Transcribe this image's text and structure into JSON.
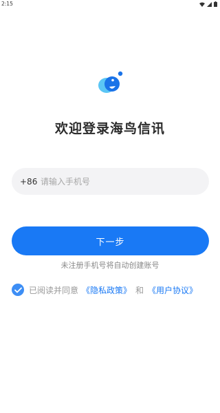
{
  "status_bar": {
    "time": "2:15",
    "icons": [
      "wifi-icon",
      "signal-icon",
      "battery-icon"
    ]
  },
  "login": {
    "title": "欢迎登录海鸟信讯",
    "phone_prefix": "+86",
    "phone_placeholder": "请输入手机号",
    "phone_value": "",
    "next_button": "下一步",
    "hint": "未注册手机号将自动创建账号",
    "agree_text": "已阅读并同意",
    "privacy_link": "《隐私政策》",
    "and_text": "和",
    "user_agreement_link": "《用户协议》",
    "agree_checked": true
  },
  "colors": {
    "accent": "#1979f5",
    "logo_light": "#5bc6f5",
    "logo_dark": "#1a73e8"
  }
}
